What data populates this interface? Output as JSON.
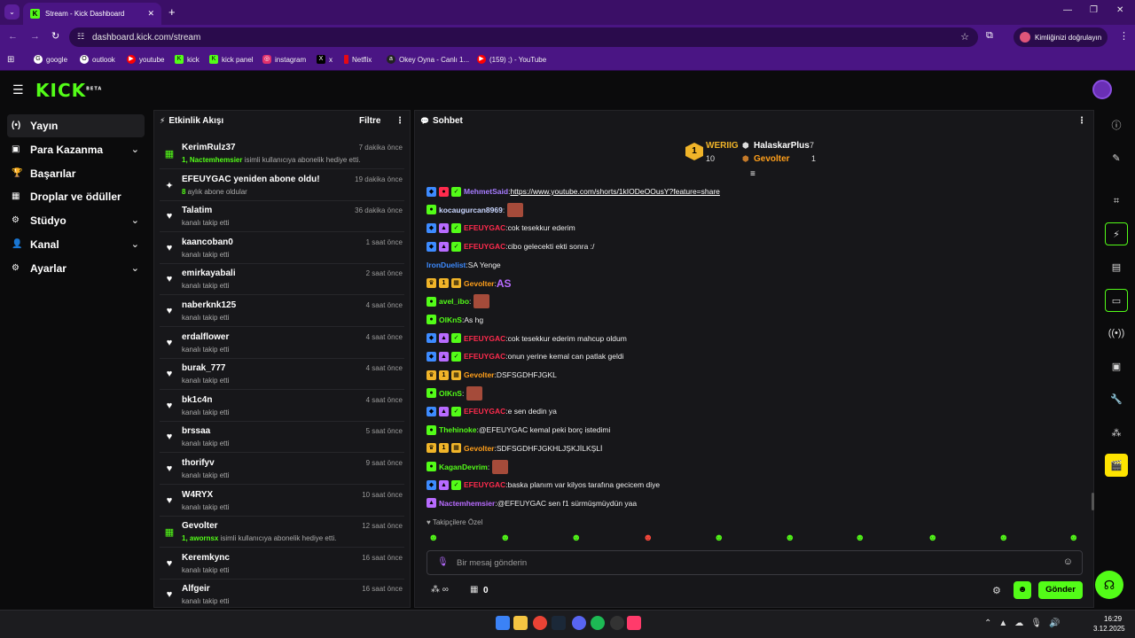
{
  "browser": {
    "tab_title": "Stream - Kick Dashboard",
    "url": "dashboard.kick.com/stream",
    "verify_label": "Kimliğinizi doğrulayın",
    "bookmarks": [
      "google",
      "outlook",
      "youtube",
      "kick",
      "kick panel",
      "instagram",
      "x",
      "Netflix",
      "Okey Oyna - Canlı 1...",
      "(159) ;) - YouTube"
    ]
  },
  "sidebar": {
    "items": [
      {
        "label": "Yayın",
        "icon": "broadcast-icon",
        "active": true,
        "chevron": false
      },
      {
        "label": "Para Kazanma",
        "icon": "wallet-icon",
        "active": false,
        "chevron": true
      },
      {
        "label": "Başarılar",
        "icon": "trophy-icon",
        "active": false,
        "chevron": false
      },
      {
        "label": "Droplar ve ödüller",
        "icon": "gift-icon",
        "active": false,
        "chevron": false
      },
      {
        "label": "Stüdyo",
        "icon": "gear-icon",
        "active": false,
        "chevron": true
      },
      {
        "label": "Kanal",
        "icon": "channel-icon",
        "active": false,
        "chevron": true
      },
      {
        "label": "Ayarlar",
        "icon": "settings-icon",
        "active": false,
        "chevron": true
      }
    ]
  },
  "activity": {
    "title": "Etkinlik Akışı",
    "filter_label": "Filtre",
    "events": [
      {
        "name": "KerimRulz37",
        "sub_bold": "1, Nactemhemsier",
        "sub": " isimli kullanıcıya abonelik hediye etti.",
        "time": "7 dakika önce",
        "icon": "gift-icon"
      },
      {
        "name": "EFEUYGAC yeniden abone oldu!",
        "sub_bold": "8",
        "sub": " aylık abone oldular",
        "time": "19 dakika önce",
        "icon": "sparkle-icon"
      },
      {
        "name": "Talatim",
        "sub_bold": "",
        "sub": "kanalı takip etti",
        "time": "36 dakika önce",
        "icon": "heart-icon"
      },
      {
        "name": "kaancoban0",
        "sub_bold": "",
        "sub": "kanalı takip etti",
        "time": "1 saat önce",
        "icon": "heart-icon"
      },
      {
        "name": "emirkayabali",
        "sub_bold": "",
        "sub": "kanalı takip etti",
        "time": "2 saat önce",
        "icon": "heart-icon"
      },
      {
        "name": "naberknk125",
        "sub_bold": "",
        "sub": "kanalı takip etti",
        "time": "4 saat önce",
        "icon": "heart-icon"
      },
      {
        "name": "erdalflower",
        "sub_bold": "",
        "sub": "kanalı takip etti",
        "time": "4 saat önce",
        "icon": "heart-icon"
      },
      {
        "name": "burak_777",
        "sub_bold": "",
        "sub": "kanalı takip etti",
        "time": "4 saat önce",
        "icon": "heart-icon"
      },
      {
        "name": "bk1c4n",
        "sub_bold": "",
        "sub": "kanalı takip etti",
        "time": "4 saat önce",
        "icon": "heart-icon"
      },
      {
        "name": "brssaa",
        "sub_bold": "",
        "sub": "kanalı takip etti",
        "time": "5 saat önce",
        "icon": "heart-icon"
      },
      {
        "name": "thorifyv",
        "sub_bold": "",
        "sub": "kanalı takip etti",
        "time": "9 saat önce",
        "icon": "heart-icon"
      },
      {
        "name": "W4RYX",
        "sub_bold": "",
        "sub": "kanalı takip etti",
        "time": "10 saat önce",
        "icon": "heart-icon"
      },
      {
        "name": "Gevolter",
        "sub_bold": "1, awornsx",
        "sub": " isimli kullanıcıya abonelik hediye etti.",
        "time": "12 saat önce",
        "icon": "gift-icon"
      },
      {
        "name": "Keremkync",
        "sub_bold": "",
        "sub": "kanalı takip etti",
        "time": "16 saat önce",
        "icon": "heart-icon"
      },
      {
        "name": "Alfgeir",
        "sub_bold": "",
        "sub": "kanalı takip etti",
        "time": "16 saat önce",
        "icon": "heart-icon"
      }
    ]
  },
  "chat": {
    "title": "Sohbet",
    "leaderboard": {
      "first_name": "WERIIG",
      "first_count": "10",
      "second_name": "HalaskarPlus",
      "second_count": "7",
      "third_name": "Gevolter",
      "third_count": "1"
    },
    "messages": [
      {
        "user": "MehmetSaid",
        "color": "#a77cff",
        "text": "https://www.youtube.com/shorts/1kIODeOOusY?feature=share",
        "link": true,
        "emote": false
      },
      {
        "user": "kocaugurcan8969",
        "color": "#c9d6ff",
        "text": "",
        "link": false,
        "emote": true
      },
      {
        "user": "EFEUYGAC",
        "color": "#ff2b4d",
        "text": "cok tesekkur ederim",
        "link": false,
        "emote": false
      },
      {
        "user": "EFEUYGAC",
        "color": "#ff2b4d",
        "text": "cibo gelecekti ekti sonra :/",
        "link": false,
        "emote": false
      },
      {
        "user": "IronDuelist",
        "color": "#3d8bff",
        "text": "SA Yenge",
        "link": false,
        "emote": false
      },
      {
        "user": "Gevolter",
        "color": "#ff9f1a",
        "text": "AS",
        "link": false,
        "emote": false
      },
      {
        "user": "avel_ibo",
        "color": "#53fc18",
        "text": "",
        "link": false,
        "emote": true
      },
      {
        "user": "OlKnS",
        "color": "#53fc18",
        "text": "As hg",
        "link": false,
        "emote": false
      },
      {
        "user": "EFEUYGAC",
        "color": "#ff2b4d",
        "text": "cok tesekkur ederim mahcup oldum",
        "link": false,
        "emote": false
      },
      {
        "user": "EFEUYGAC",
        "color": "#ff2b4d",
        "text": "onun yerine kemal can patlak geldi",
        "link": false,
        "emote": false
      },
      {
        "user": "Gevolter",
        "color": "#ff9f1a",
        "text": "DSFSGDHFJGKL",
        "link": false,
        "emote": false
      },
      {
        "user": "OlKnS",
        "color": "#53fc18",
        "text": "",
        "link": false,
        "emote": true
      },
      {
        "user": "EFEUYGAC",
        "color": "#ff2b4d",
        "text": "e sen dedin ya",
        "link": false,
        "emote": false
      },
      {
        "user": "Thehinoke",
        "color": "#53fc18",
        "text": "@EFEUYGAC kemal peki borç istedimi",
        "link": false,
        "emote": false
      },
      {
        "user": "Gevolter",
        "color": "#ff9f1a",
        "text": "SDFSGDHFJGKHLJŞKJİLKŞLİ",
        "link": false,
        "emote": false
      },
      {
        "user": "KaganDevrim",
        "color": "#53fc18",
        "text": "",
        "link": false,
        "emote": true
      },
      {
        "user": "EFEUYGAC",
        "color": "#ff2b4d",
        "text": "baska planım var kilyos tarafına gecicem diye",
        "link": false,
        "emote": false
      },
      {
        "user": "Nactemhemsier",
        "color": "#b86bff",
        "text": "@EFEUYGAC sen f1 sürmüşmüydün yaa",
        "link": false,
        "emote": false
      }
    ],
    "followers_only_label": "Takipçilere Özel",
    "input_placeholder": "Bir mesaj gönderin",
    "points": "0",
    "send_label": "Gönder"
  },
  "taskbar": {
    "time": "16:29",
    "date": "3.12.2025"
  },
  "colors": {
    "brand": "#53fc18",
    "chrome": "#4a1584"
  }
}
